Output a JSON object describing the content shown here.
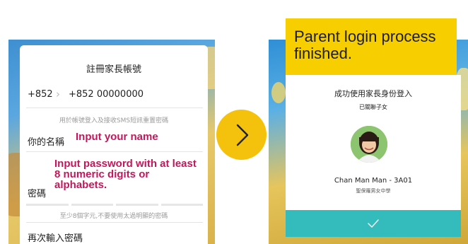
{
  "register_screen": {
    "title": "註冊家長帳號",
    "phone_country_code": "+852",
    "phone_value": "+852 00000000",
    "phone_hint": "用於帳號登入及接收SMS短訊重置密碼",
    "name_label": "你的名稱",
    "name_annotation": "Input your name",
    "password_annotation": "Input password with at least 8 numeric digits or alphabets.",
    "password_label": "密碼",
    "password_hint": "至少8個字元,不要使用太過明顯的密碼",
    "confirm_password_label": "再次輸入密碼"
  },
  "next_button": {
    "icon": "chevron-right-icon"
  },
  "success_screen": {
    "banner": "Parent login process finished.",
    "title": "成功使用家長身份登入",
    "subtitle": "已關聯子女",
    "student_name": "Chan Man Man - 3A01",
    "school_name": "聖保羅男女中學",
    "confirm_icon": "check-icon"
  },
  "colors": {
    "accent_yellow": "#f4c20d",
    "annotation_red": "#c2185b",
    "confirm_teal": "#34bcbc"
  }
}
